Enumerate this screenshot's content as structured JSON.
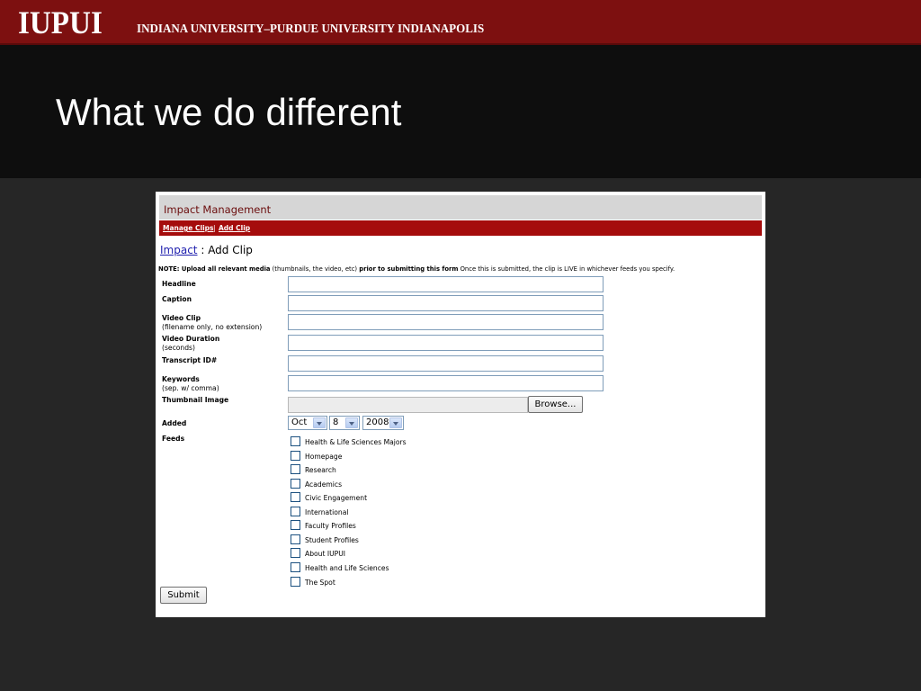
{
  "slide": {
    "logo": "IUPUI",
    "university_name": "INDIANA UNIVERSITY–PURDUE UNIVERSITY INDIANAPOLIS",
    "title": "What we do different"
  },
  "app": {
    "title": "Impact Management",
    "nav": {
      "manage_clips": "Manage Clips",
      "separator": "|",
      "add_clip": "Add Clip"
    },
    "breadcrumb": {
      "link": "Impact",
      "rest": " : Add Clip"
    },
    "note": {
      "p1": "NOTE: Upload all relevant media",
      "p2": " (thumbnails, the video, etc) ",
      "p3": "prior to submitting this form",
      "p4": " Once this is submitted, the clip is LIVE in whichever feeds you specify."
    },
    "form": {
      "headline": "Headline",
      "caption": "Caption",
      "video_clip": "Video Clip",
      "video_clip_hint": "(filename only, no extension)",
      "video_duration": "Video Duration",
      "video_duration_hint": "(seconds)",
      "transcript_id": "Transcript ID#",
      "keywords": "Keywords",
      "keywords_hint": "(sep. w/ comma)",
      "thumbnail_image": "Thumbnail Image",
      "browse": "Browse...",
      "added": "Added",
      "added_month": "Oct",
      "added_day": "8",
      "added_year": "2008",
      "feeds": "Feeds",
      "submit": "Submit"
    },
    "feeds": [
      "Health & Life Sciences Majors",
      "Homepage",
      "Research",
      "Academics",
      "Civic Engagement",
      "International",
      "Faculty Profiles",
      "Student Profiles",
      "About IUPUI",
      "Health and Life Sciences",
      "The Spot"
    ]
  },
  "colors": {
    "brand_red": "#7d1010",
    "nav_red": "#a50c0c",
    "title_band": "#0e0e0e",
    "background": "#262626"
  }
}
